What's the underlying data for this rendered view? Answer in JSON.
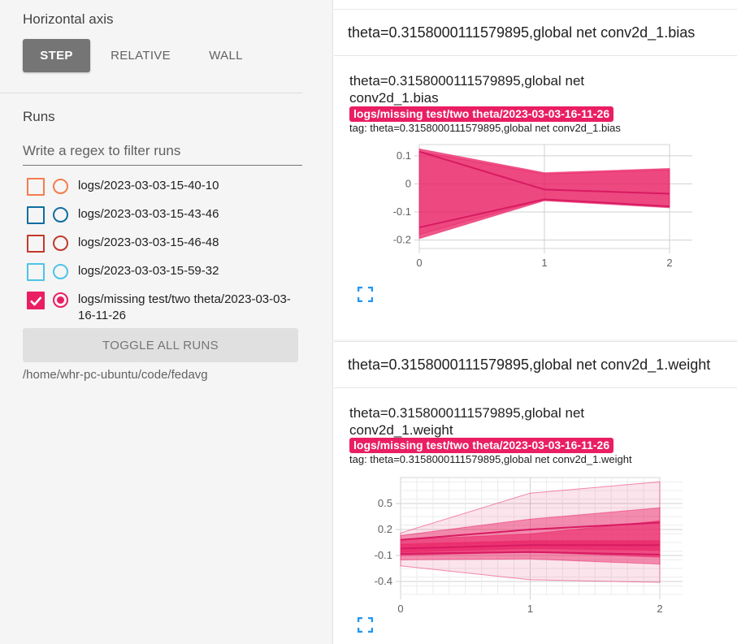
{
  "sidebar": {
    "horizontal_axis_title": "Horizontal axis",
    "axis_options": [
      {
        "label": "STEP",
        "active": true
      },
      {
        "label": "RELATIVE",
        "active": false
      },
      {
        "label": "WALL",
        "active": false
      }
    ],
    "runs_title": "Runs",
    "filter_placeholder": "Write a regex to filter runs",
    "runs": [
      {
        "label": "logs/2023-03-03-15-40-10",
        "color": "#f57c4c",
        "checked": false
      },
      {
        "label": "logs/2023-03-03-15-43-46",
        "color": "#0f6e9e",
        "checked": false
      },
      {
        "label": "logs/2023-03-03-15-46-48",
        "color": "#c0392b",
        "checked": false
      },
      {
        "label": "logs/2023-03-03-15-59-32",
        "color": "#4fc3e8",
        "checked": false
      },
      {
        "label": "logs/missing test/two theta/2023-03-03-16-11-26",
        "color": "#e91e63",
        "checked": true
      }
    ],
    "toggle_all_label": "TOGGLE ALL RUNS",
    "log_path": "/home/whr-pc-ubuntu/code/fedavg"
  },
  "cards": [
    {
      "header": "theta=0.3158000111579895,global net conv2d_1.bias",
      "chart_title": "theta=0.3158000111579895,global net conv2d_1.bias",
      "run_chip": "logs/missing test/two theta/2023-03-03-16-11-26",
      "tag_line": "tag: theta=0.3158000111579895,global net conv2d_1.bias"
    },
    {
      "header": "theta=0.3158000111579895,global net conv2d_1.weight",
      "chart_title": "theta=0.3158000111579895,global net conv2d_1.weight",
      "run_chip": "logs/missing test/two theta/2023-03-03-16-11-26",
      "tag_line": "tag: theta=0.3158000111579895,global net conv2d_1.weight"
    }
  ],
  "chart_data": [
    {
      "type": "area",
      "title": "theta=0.3158000111579895,global net conv2d_1.bias",
      "color": "#e91e63",
      "x": [
        0,
        1,
        2
      ],
      "x_ticks": [
        "0",
        "1",
        "2"
      ],
      "y_ticks": [
        "0.1",
        "0",
        "-0.1",
        "-0.2"
      ],
      "y_tick_values": [
        0.1,
        0,
        -0.1,
        -0.2
      ],
      "ylim": [
        -0.23,
        0.14
      ],
      "bands": [
        {
          "upper": [
            0.125,
            0.04,
            0.055
          ],
          "lower": [
            -0.195,
            -0.06,
            -0.085
          ],
          "opacity": 0.75
        },
        {
          "upper": [
            0.115,
            0.035,
            0.05
          ],
          "lower": [
            -0.18,
            -0.055,
            -0.08
          ],
          "opacity": 0.25
        }
      ],
      "lines": [
        [
          0.115,
          -0.02,
          -0.035
        ],
        [
          -0.155,
          -0.055,
          -0.08
        ]
      ],
      "grid": true
    },
    {
      "type": "area",
      "title": "theta=0.3158000111579895,global net conv2d_1.weight",
      "color": "#e91e63",
      "x": [
        0,
        1,
        2
      ],
      "x_ticks": [
        "0",
        "1",
        "2"
      ],
      "y_ticks": [
        "0.5",
        "0.2",
        "-0.1",
        "-0.4"
      ],
      "y_tick_values": [
        0.5,
        0.2,
        -0.1,
        -0.4
      ],
      "ylim": [
        -0.55,
        0.8
      ],
      "bands": [
        {
          "upper": [
            0.16,
            0.62,
            0.75
          ],
          "lower": [
            -0.22,
            -0.38,
            -0.41
          ],
          "opacity": 0.12
        },
        {
          "upper": [
            0.13,
            0.32,
            0.45
          ],
          "lower": [
            -0.15,
            -0.14,
            -0.2
          ],
          "opacity": 0.45
        },
        {
          "upper": [
            0.08,
            0.15,
            0.3
          ],
          "lower": [
            -0.1,
            -0.06,
            -0.12
          ],
          "opacity": 0.55
        },
        {
          "upper": [
            0.03,
            0.07,
            0.07
          ],
          "lower": [
            -0.06,
            -0.02,
            -0.04
          ],
          "opacity": 0.6
        }
      ],
      "lines": [
        [
          0.08,
          0.2,
          0.28
        ],
        [
          -0.02,
          0.02,
          0.02
        ],
        [
          -0.08,
          -0.06,
          -0.09
        ]
      ],
      "grid": true
    }
  ]
}
